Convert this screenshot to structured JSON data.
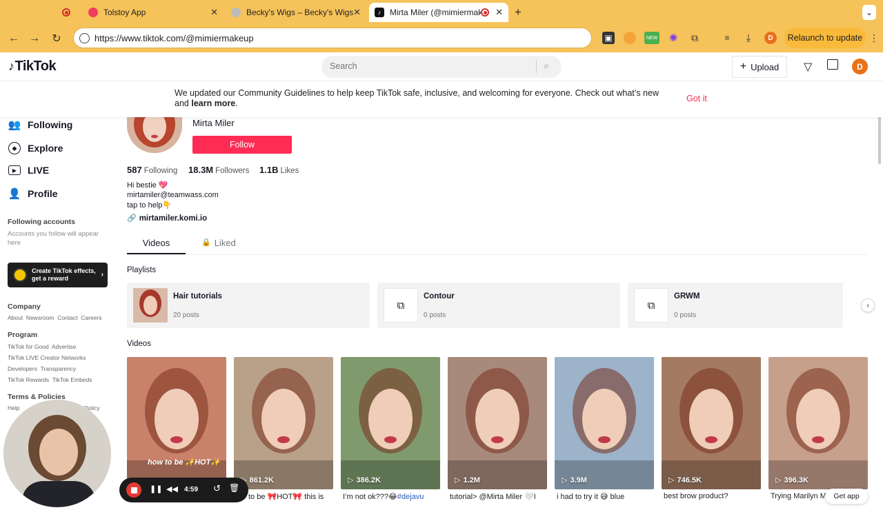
{
  "browser": {
    "tabs": [
      {
        "label": "Tolstoy App"
      },
      {
        "label": "Becky's Wigs – Becky's Wigs"
      },
      {
        "label": "Mirta Miler (@mimiermake"
      }
    ],
    "url": "https://www.tiktok.com/@mimiermakeup",
    "relaunch_label": "Relaunch to update",
    "profile_initial": "D",
    "ext_new_badge": "NEW",
    "new_tab_label": "+",
    "menu_label": "⌄"
  },
  "header": {
    "logo_text": "TikTok",
    "search_placeholder": "Search",
    "upload_label": "Upload",
    "avatar_initial": "D"
  },
  "banner": {
    "message": "We updated our Community Guidelines to help keep TikTok safe, inclusive, and welcoming for everyone. Check out what’s new and ",
    "link": "learn more",
    "suffix": ".",
    "dismiss": "Got it"
  },
  "sidebar": {
    "nav": [
      {
        "label": "Following",
        "icon": "users-icon"
      },
      {
        "label": "Explore",
        "icon": "compass-icon"
      },
      {
        "label": "LIVE",
        "icon": "live-icon"
      },
      {
        "label": "Profile",
        "icon": "person-icon"
      }
    ],
    "following_accounts_title": "Following accounts",
    "following_accounts_hint": "Accounts you follow will appear here",
    "effects_line1": "Create TikTok effects,",
    "effects_line2": "get a reward",
    "company_title": "Company",
    "company_links": "About  Newsroom  Contact  Careers",
    "program_title": "Program",
    "program_line1": "TikTok for Good  Advertise",
    "program_line2": "TikTok LIVE Creator Networks",
    "program_line3": "Developers  Transparency",
    "program_line4": "TikTok Rewards  TikTok Embeds",
    "terms_title": "Terms & Policies",
    "terms_line1": "Help",
    "terms_line1b": "Policy"
  },
  "profile": {
    "name": "Mirta Miler",
    "follow_label": "Follow",
    "stats": {
      "following_value": "587",
      "following_label": "Following",
      "followers_value": "18.3M",
      "followers_label": "Followers",
      "likes_value": "1.1B",
      "likes_label": "Likes"
    },
    "bio_line1": "Hi bestie 💖",
    "bio_line2": "mirtamiler@teamwass.com",
    "bio_line3": "tap to help👇",
    "link": "mirtamiler.komi.io"
  },
  "tabs": {
    "videos": "Videos",
    "liked": "Liked"
  },
  "playlists_title": "Playlists",
  "playlists": [
    {
      "title": "Hair tutorials",
      "count": "20 posts"
    },
    {
      "title": "Contour",
      "count": "0 posts"
    },
    {
      "title": "GRWM",
      "count": "0 posts"
    }
  ],
  "videos_title": "Videos",
  "videos": [
    {
      "views": "",
      "caption": "",
      "overlay": "how to be ✨HOT✨",
      "bg": "#c9826a"
    },
    {
      "views": "861.2K",
      "caption": "w to be 🎀HOT🎀 this is",
      "tag": "",
      "bg": "#b9a089"
    },
    {
      "views": "386.2K",
      "caption": "I’m not ok???😂",
      "tag": "#dejavu",
      "bg": "#7f9b6e"
    },
    {
      "views": "1.2M",
      "caption": "tutorial> @Mirta Miler 🤍I",
      "tag": "",
      "bg": "#a88a7d"
    },
    {
      "views": "3.9M",
      "caption": "i had to try it 😅 blue",
      "tag": "",
      "bg": "#9cb3c9"
    },
    {
      "views": "746.5K",
      "caption": "best brow product?",
      "tag": "",
      "bg": "#a47b62"
    },
    {
      "views": "396.3K",
      "caption": "Trying Marilyn M",
      "tag": "",
      "bg": "#c7a08c"
    }
  ],
  "recorder": {
    "time": "4:59"
  },
  "get_app": "Get app"
}
